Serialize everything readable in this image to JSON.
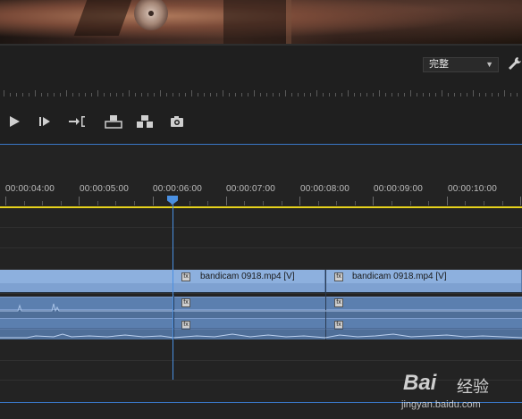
{
  "monitor": {
    "quality_value": "完整",
    "controls": [
      {
        "name": "play-icon"
      },
      {
        "name": "step-forward-icon"
      },
      {
        "name": "go-to-out-icon"
      },
      {
        "name": "lift-icon"
      },
      {
        "name": "extract-icon"
      },
      {
        "name": "export-frame-icon"
      }
    ]
  },
  "timeline": {
    "timecodes": [
      "00:00:04:00",
      "00:00:05:00",
      "00:00:06:00",
      "00:00:07:00",
      "00:00:08:00",
      "00:00:09:00",
      "00:00:10:00"
    ],
    "current_time": "00:00:06:00",
    "clips": [
      {
        "label": "bandicam 0918.mp4 [V]"
      },
      {
        "label": "bandicam 0918.mp4 [V]"
      }
    ],
    "fx_label": "fx"
  },
  "watermark": {
    "brand": "Bai",
    "product": "经验",
    "url": "jingyan.baidu.com"
  },
  "colors": {
    "accent": "#4a90e2",
    "work_area": "#e6d21c",
    "video_clip": "#7ea1d1",
    "audio_clip": "#5b7faf"
  }
}
